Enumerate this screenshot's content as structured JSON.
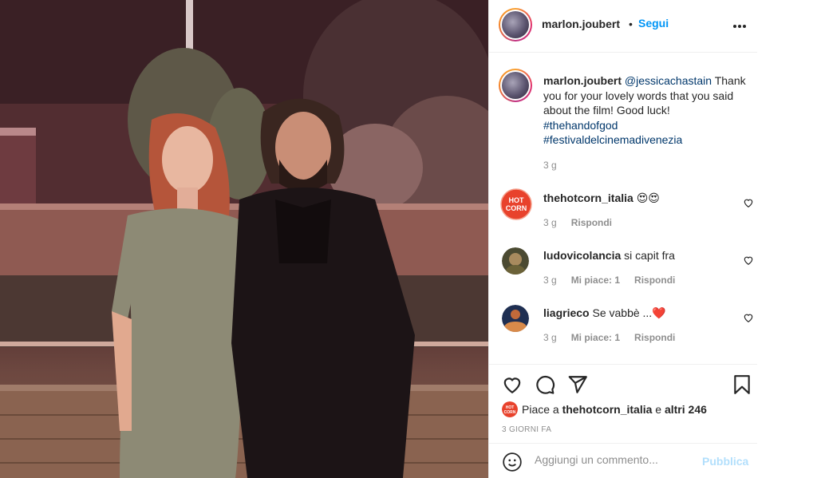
{
  "post": {
    "author": "marlon.joubert",
    "separator": "•",
    "follow_label": "Segui",
    "caption": {
      "username": "marlon.joubert",
      "mention": "@jessicachastain",
      "text": "Thank you for your lovely words that you said about the film! Good luck!",
      "hashtag1": "#thehandofgod",
      "hashtag2": "#festivaldelcinemadivenezia",
      "time": "3 g"
    },
    "comments": [
      {
        "username": "thehotcorn_italia",
        "text": "😍😍",
        "time": "3 g",
        "likes": "",
        "reply": "Rispondi",
        "avatar_text": "HOT CORN"
      },
      {
        "username": "ludovicolancia",
        "text": "si capit fra",
        "time": "3 g",
        "likes": "Mi piace: 1",
        "reply": "Rispondi"
      },
      {
        "username": "liagrieco",
        "text": "Se vabbè ...❤️",
        "time": "3 g",
        "likes": "Mi piace: 1",
        "reply": "Rispondi"
      }
    ],
    "likes": {
      "prefix": "Piace a",
      "user": "thehotcorn_italia",
      "connector": "e",
      "others": "altri 246"
    },
    "date": "3 GIORNI FA",
    "comment_box": {
      "placeholder": "Aggiungi un commento...",
      "publish_label": "Pubblica"
    }
  },
  "colors": {
    "link_blue": "#0095f6",
    "hashtag_blue": "#00376b",
    "muted": "#8e8e8e",
    "publish_disabled": "#b2dffc",
    "heart_red": "#ed4956"
  },
  "icons": {
    "more": "more-options-icon",
    "like": "heart-icon",
    "comment": "comment-bubble-icon",
    "share": "paper-plane-icon",
    "save": "bookmark-icon",
    "emoji": "emoji-smiley-icon"
  }
}
